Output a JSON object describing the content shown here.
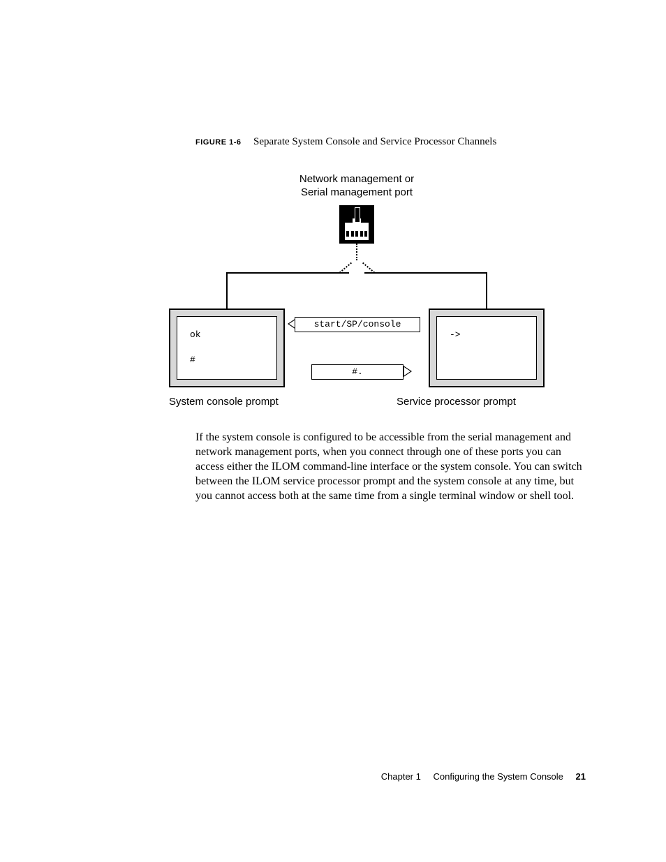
{
  "figure": {
    "label": "FIGURE 1-6",
    "title": "Separate System Console and Service Processor Channels"
  },
  "diagram": {
    "top_label_line1": "Network management or",
    "top_label_line2": "Serial management port",
    "left_box": {
      "line1": "ok",
      "line2": "#",
      "caption": "System console prompt"
    },
    "right_box": {
      "line1": "->",
      "caption": "Service processor prompt"
    },
    "arrow_top_cmd": "start/SP/console",
    "arrow_bottom_cmd": "#."
  },
  "paragraph": "If the system console is configured to be accessible from the serial management and network management ports, when you connect through one of these ports you can access either the ILOM command-line interface or the system console. You can switch between the ILOM service processor prompt and the system console at any time, but you cannot access both at the same time from a single terminal window or shell tool.",
  "footer": {
    "chapter": "Chapter 1",
    "title": "Configuring the System Console",
    "page": "21"
  }
}
